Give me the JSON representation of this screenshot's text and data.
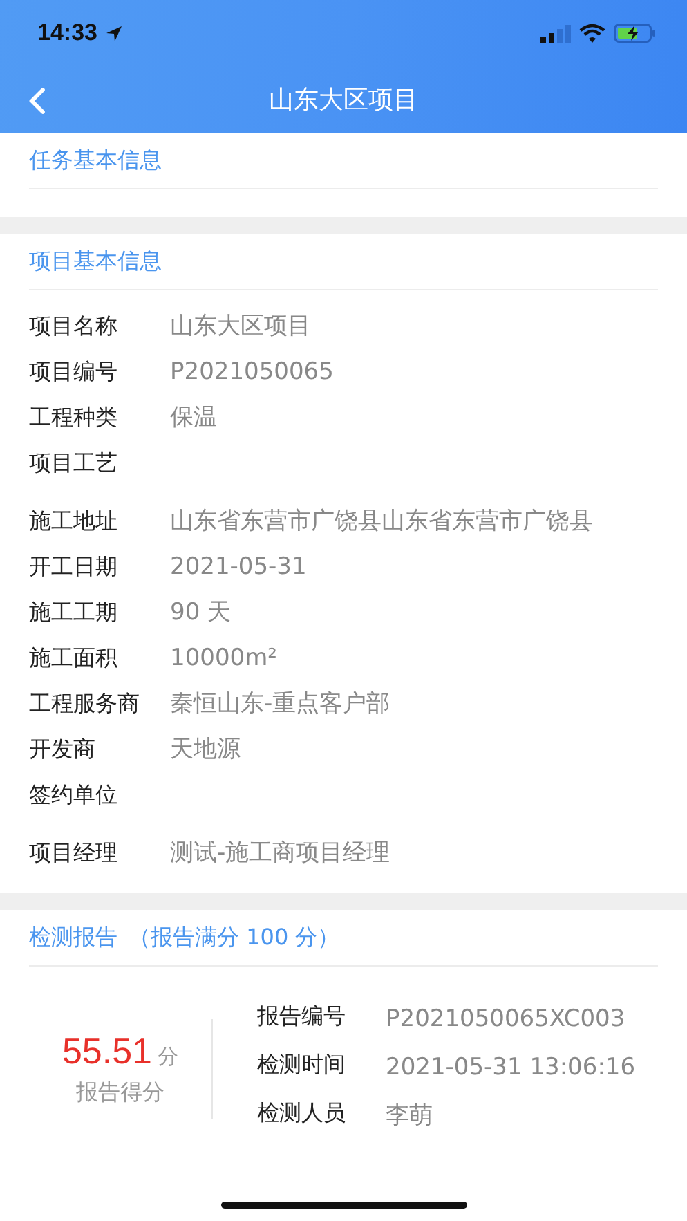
{
  "status_bar": {
    "time": "14:33"
  },
  "nav": {
    "title": "山东大区项目"
  },
  "task_section": {
    "title": "任务基本信息"
  },
  "project_section": {
    "title": "项目基本信息",
    "rows": [
      {
        "label": "项目名称",
        "value": "山东大区项目"
      },
      {
        "label": "项目编号",
        "value": "P2021050065"
      },
      {
        "label": "工程种类",
        "value": "保温"
      },
      {
        "label": "项目工艺"
      },
      {
        "label": "施工地址",
        "value": "山东省东营市广饶县山东省东营市广饶县"
      },
      {
        "label": "开工日期",
        "value": "2021-05-31"
      },
      {
        "label": "施工工期",
        "value": "90 天"
      },
      {
        "label": "施工面积",
        "value": "10000m²"
      },
      {
        "label": "工程服务商",
        "value": "秦恒山东-重点客户部"
      },
      {
        "label": "开发商",
        "value": "天地源"
      },
      {
        "label": "签约单位"
      },
      {
        "label": "项目经理",
        "value": "测试-施工商项目经理"
      }
    ]
  },
  "report_section": {
    "title": "检测报告",
    "subtitle": "（报告满分 100 分）",
    "score": "55.51",
    "score_unit": "分",
    "score_label": "报告得分",
    "rows": [
      {
        "label": "报告编号",
        "value": "P2021050065XC003"
      },
      {
        "label": "检测时间",
        "value": "2021-05-31 13:06:16"
      },
      {
        "label": "检测人员",
        "value": "李萌"
      }
    ]
  }
}
